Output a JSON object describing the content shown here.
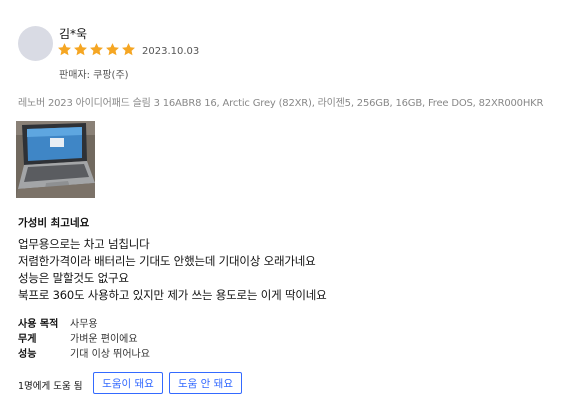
{
  "reviewer": {
    "name": "김*욱",
    "rating": 5,
    "rating_max": 5,
    "star_color": "#f5a623",
    "date": "2023.10.03",
    "seller": "판매자: 쿠팡(주)"
  },
  "product": {
    "name": "레노버 2023 아이디어패드 슬림 3 16ABR8 16, Arctic Grey (82XR), 라이젠5, 256GB, 16GB, Free DOS, 82XR000HKR"
  },
  "photo": {
    "icon": "laptop-photo"
  },
  "review": {
    "headline": "가성비 최고네요",
    "lines": [
      "업무용으로는 차고 넘칩니다",
      "저렴한가격이라 배터리는 기대도 안했는데 기대이상 오래가네요",
      "성능은 말할것도 없구요",
      "북프로 360도 사용하고 있지만 제가 쓰는 용도로는 이게 딱이네요"
    ]
  },
  "attributes": [
    {
      "label": "사용 목적",
      "value": "사무용"
    },
    {
      "label": "무게",
      "value": "가벼운 편이에요"
    },
    {
      "label": "성능",
      "value": "기대 이상 뛰어나요"
    }
  ],
  "helpful": {
    "count_text": "1명에게 도움 됨",
    "yes_label": "도움이 돼요",
    "no_label": "도움 안 돼요",
    "accent_color": "#346aff"
  }
}
